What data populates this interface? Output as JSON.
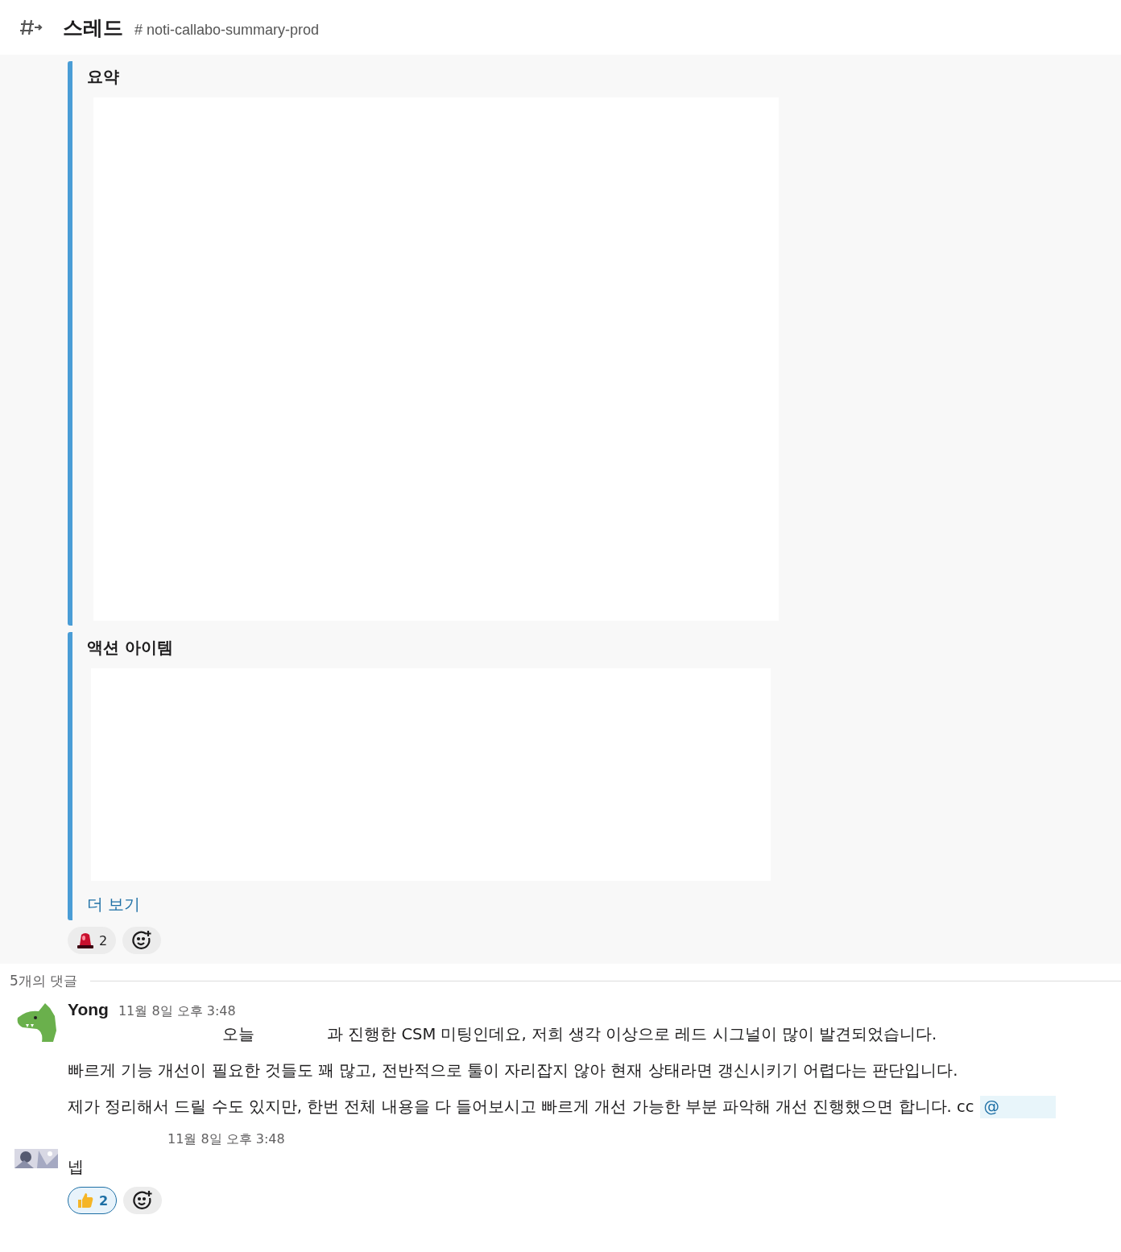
{
  "header": {
    "title": "스레드",
    "channel": "# noti-callabo-summary-prod"
  },
  "parent": {
    "sections": [
      {
        "title": "요약",
        "kind": "summary"
      },
      {
        "title": "액션 아이템",
        "kind": "actions"
      }
    ],
    "more_link": "더 보기",
    "reactions": [
      {
        "kind": "siren",
        "count": "2",
        "selected": false
      },
      {
        "kind": "add"
      }
    ]
  },
  "replies_divider": "5개의 댓글",
  "messages": [
    {
      "kind": "dragon",
      "author": "Yong",
      "time": "11월 8일 오후 3:48",
      "lines": [
        {
          "kind": "masked",
          "parts": [
            "오늘",
            "과 진행한 CSM 미팅인데요, 저희 생각 이상으로 레드 시그널이 많이 발견되었습니다."
          ]
        },
        {
          "kind": "plain",
          "parts": [
            "빠르게 기능 개선이 필요한 것들도 꽤 많고, 전반적으로 툴이 자리잡지 않아 현재 상태라면 갱신시키기 어렵다는 판단입니다."
          ]
        },
        {
          "kind": "plain",
          "parts": [
            "제가 정리해서 드릴 수도 있지만, 한번 전체 내용을 다 들어보시고 빠르게 개선 가능한 부분 파악해 개선 진행했으면 합니다. cc"
          ],
          "mention": "@"
        }
      ]
    },
    {
      "time": "11월 8일 오후 3:48",
      "lines": [
        {
          "kind": "plain",
          "parts": [
            "넵"
          ]
        }
      ],
      "reactions": [
        {
          "kind": "thumbs-up",
          "count": "2",
          "selected": true
        },
        {
          "kind": "add"
        }
      ]
    }
  ]
}
